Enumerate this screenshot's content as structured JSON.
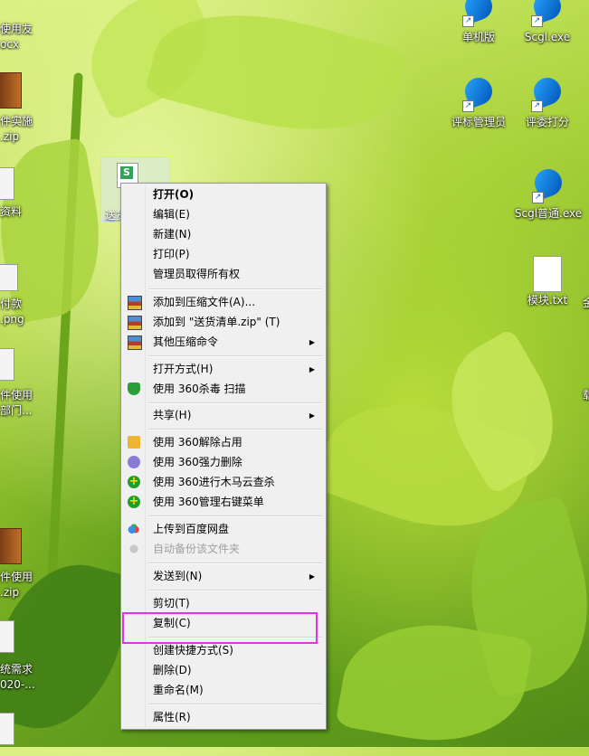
{
  "desktop": {
    "left_edge_labels": [
      {
        "text": "使用友"
      },
      {
        "text": "ocx"
      },
      {
        "text": "件实施"
      },
      {
        "text": ".zip"
      },
      {
        "text": "资料"
      },
      {
        "text": "付款"
      },
      {
        "text": ".png"
      },
      {
        "text": "件使用"
      },
      {
        "text": "部门..."
      },
      {
        "text": "件使用"
      },
      {
        "text": ".zip"
      },
      {
        "text": "统需求"
      },
      {
        "text": "020-..."
      }
    ],
    "right_icons": [
      {
        "label": "单机版",
        "icon": "app-shortcut-icon"
      },
      {
        "label": "Scgl.exe",
        "icon": "app-shortcut-icon"
      },
      {
        "label": "评标管理员",
        "icon": "app-shortcut-icon"
      },
      {
        "label": "评委打分",
        "icon": "app-shortcut-icon"
      },
      {
        "label": "Scgl普通.exe",
        "icon": "app-shortcut-icon"
      },
      {
        "label": "模块.txt",
        "icon": "text-file-icon"
      }
    ],
    "right_edge_fragments": [
      "金",
      "载"
    ],
    "selected_file": {
      "label": "送货",
      "icon_letter": "S"
    }
  },
  "context_menu": {
    "items": [
      {
        "label": "打开(O)",
        "bold": true
      },
      {
        "label": "编辑(E)"
      },
      {
        "label": "新建(N)"
      },
      {
        "label": "打印(P)"
      },
      {
        "label": "管理员取得所有权"
      },
      {
        "label": "添加到压缩文件(A)...",
        "icon": "winrar-icon"
      },
      {
        "label": "添加到 \"送货清单.zip\" (T)",
        "icon": "winrar-icon"
      },
      {
        "label": "其他压缩命令",
        "icon": "winrar-icon",
        "submenu": true
      },
      {
        "label": "打开方式(H)",
        "submenu": true
      },
      {
        "label": "使用 360杀毒 扫描",
        "icon": "360-shield-icon"
      },
      {
        "label": "共享(H)",
        "submenu": true
      },
      {
        "label": "使用 360解除占用",
        "icon": "360-unlock-icon"
      },
      {
        "label": "使用 360强力删除",
        "icon": "360-delete-icon"
      },
      {
        "label": "使用 360进行木马云查杀",
        "icon": "360-plus-icon"
      },
      {
        "label": "使用 360管理右键菜单",
        "icon": "360-plus-icon"
      },
      {
        "label": "上传到百度网盘",
        "icon": "baidu-cloud-icon"
      },
      {
        "label": "自动备份该文件夹",
        "icon": "baidu-cloud-icon",
        "disabled": true
      },
      {
        "label": "发送到(N)",
        "submenu": true
      },
      {
        "label": "剪切(T)"
      },
      {
        "label": "复制(C)",
        "highlighted": true
      },
      {
        "label": "创建快捷方式(S)"
      },
      {
        "label": "删除(D)"
      },
      {
        "label": "重命名(M)"
      },
      {
        "label": "属性(R)"
      }
    ],
    "submenu_arrow": "▶"
  },
  "colors": {
    "highlight_border": "#e233e6",
    "menu_bg": "#f0f0f0"
  }
}
